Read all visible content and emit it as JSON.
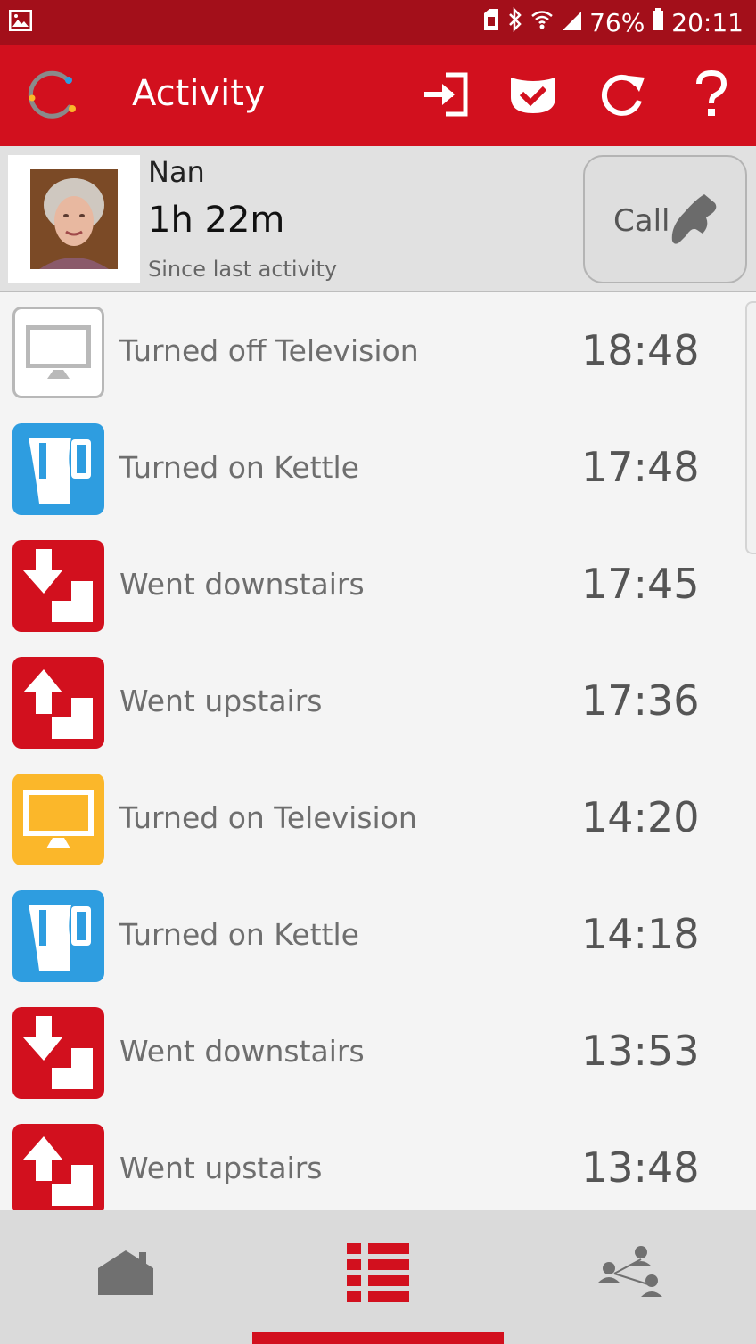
{
  "status_bar": {
    "battery": "76%",
    "time": "20:11"
  },
  "app_bar": {
    "title": "Activity",
    "actions": [
      "sign-in-icon",
      "shield-check-icon",
      "refresh-icon",
      "help-icon"
    ]
  },
  "profile": {
    "name": "Nan",
    "elapsed": "1h 22m",
    "since_label": "Since last activity",
    "call_label": "Call"
  },
  "activities": [
    {
      "label": "Turned off Television",
      "time": "18:48",
      "icon": "tv-off-icon",
      "color": "#ffffff"
    },
    {
      "label": "Turned on Kettle",
      "time": "17:48",
      "icon": "kettle-icon",
      "color": "#2e9de0"
    },
    {
      "label": "Went downstairs",
      "time": "17:45",
      "icon": "downstairs-icon",
      "color": "#d2101e"
    },
    {
      "label": "Went upstairs",
      "time": "17:36",
      "icon": "upstairs-icon",
      "color": "#d2101e"
    },
    {
      "label": "Turned on Television",
      "time": "14:20",
      "icon": "tv-on-icon",
      "color": "#fbb72a"
    },
    {
      "label": "Turned on Kettle",
      "time": "14:18",
      "icon": "kettle-icon",
      "color": "#2e9de0"
    },
    {
      "label": "Went downstairs",
      "time": "13:53",
      "icon": "downstairs-icon",
      "color": "#d2101e"
    },
    {
      "label": "Went upstairs",
      "time": "13:48",
      "icon": "upstairs-icon",
      "color": "#d2101e"
    }
  ],
  "bottom_nav": {
    "items": [
      "home-icon",
      "activity-list-icon",
      "network-icon"
    ],
    "selected": "activity-list-icon"
  },
  "colors": {
    "brand_red": "#d2101e",
    "status_red": "#a30f1a",
    "kettle_blue": "#2e9de0",
    "tv_yellow": "#fbb72a"
  }
}
